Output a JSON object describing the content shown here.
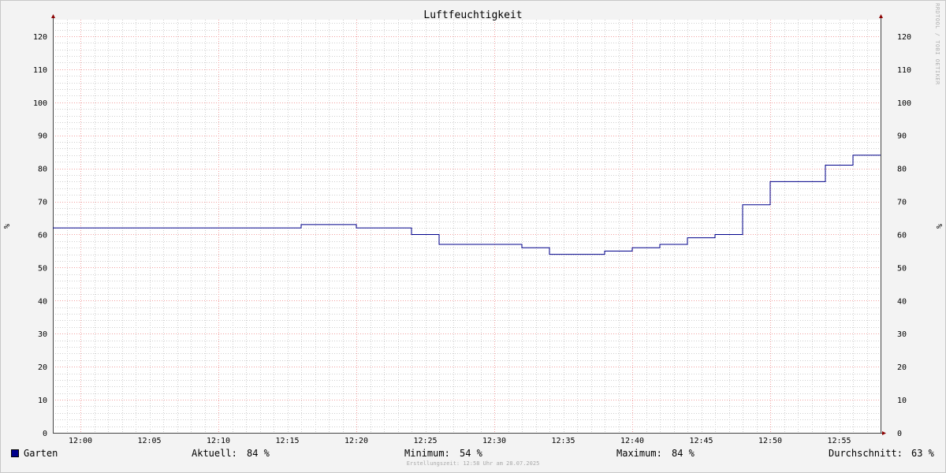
{
  "chart_data": {
    "type": "line",
    "title": "Luftfeuchtigkeit",
    "ylabel": "%",
    "ylabel_right": "%",
    "ylim": [
      0,
      125
    ],
    "yticks": [
      0,
      10,
      20,
      30,
      40,
      50,
      60,
      70,
      80,
      90,
      100,
      110,
      120
    ],
    "xlim": [
      "11:58",
      "12:58"
    ],
    "xticks": [
      "12:00",
      "12:05",
      "12:10",
      "12:15",
      "12:20",
      "12:25",
      "12:30",
      "12:35",
      "12:40",
      "12:45",
      "12:50",
      "12:55"
    ],
    "grid": true,
    "series": [
      {
        "name": "Garten",
        "color": "#00008b",
        "step": true,
        "x": [
          "11:58",
          "12:16",
          "12:20",
          "12:24",
          "12:26",
          "12:32",
          "12:34",
          "12:38",
          "12:40",
          "12:42",
          "12:44",
          "12:46",
          "12:48",
          "12:50",
          "12:52",
          "12:54",
          "12:56",
          "12:58"
        ],
        "y": [
          62,
          63,
          62,
          60,
          57,
          56,
          54,
          55,
          56,
          57,
          59,
          60,
          69,
          76,
          76,
          81,
          84,
          84
        ]
      }
    ]
  },
  "legend": {
    "series_name": "Garten",
    "current_label": "Aktuell:",
    "current_value": "84 %",
    "min_label": "Minimum:",
    "min_value": "54 %",
    "max_label": "Maximum:",
    "max_value": "84 %",
    "avg_label": "Durchschnitt:",
    "avg_value": "63 %"
  },
  "footer": "Erstellungszeit: 12:58 Uhr am 28.07.2025",
  "watermark": "RRDTOOL / TOBI OETIKER",
  "colors": {
    "line": "#00008b",
    "major_grid": "#f2a0a0",
    "minor_grid": "#cfcfcf",
    "plot_bg": "#ffffff",
    "canvas_bg": "#f3f3f3"
  }
}
